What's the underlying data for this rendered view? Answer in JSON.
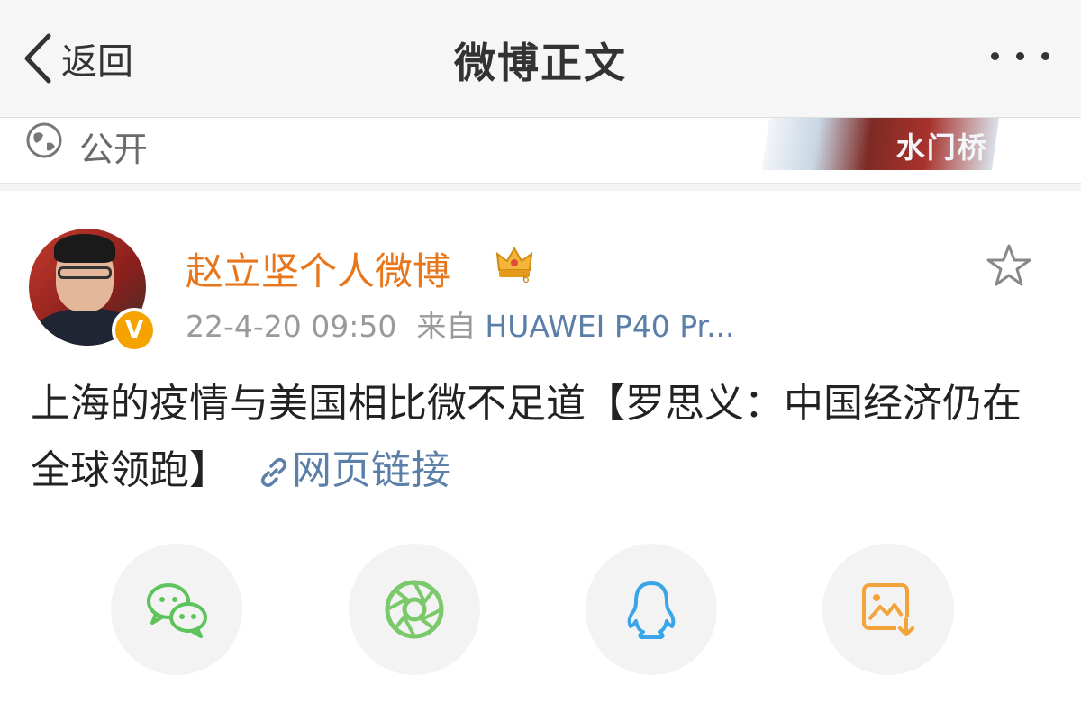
{
  "nav": {
    "back_label": "返回",
    "title": "微博正文",
    "more_icon": "more-dots-icon"
  },
  "previous_post": {
    "visibility_icon": "globe-icon",
    "visibility_label": "公开",
    "banner_text": "水门桥"
  },
  "post": {
    "author": "赵立坚个人微博",
    "verified_badge": "V",
    "member_badge_icon": "crown-icon",
    "timestamp": "22-4-20 09:50",
    "source_prefix": "来自",
    "source_device": "HUAWEI P40 Pr...",
    "text": "上海的疫情与美国相比微不足道【罗思义：中国经济仍在全球领跑】",
    "link_label": "网页链接",
    "favorite_icon": "star-icon"
  },
  "share": [
    {
      "name": "wechat",
      "icon": "wechat-icon",
      "color": "#5cc45a"
    },
    {
      "name": "moments",
      "icon": "moments-icon",
      "color": "#7bc96a"
    },
    {
      "name": "qq",
      "icon": "qq-icon",
      "color": "#3aa6e8"
    },
    {
      "name": "save-image",
      "icon": "save-image-icon",
      "color": "#f2a33a"
    }
  ],
  "colors": {
    "username": "#e8761a",
    "link": "#5b7fa8",
    "meta": "#9a9a9a"
  }
}
